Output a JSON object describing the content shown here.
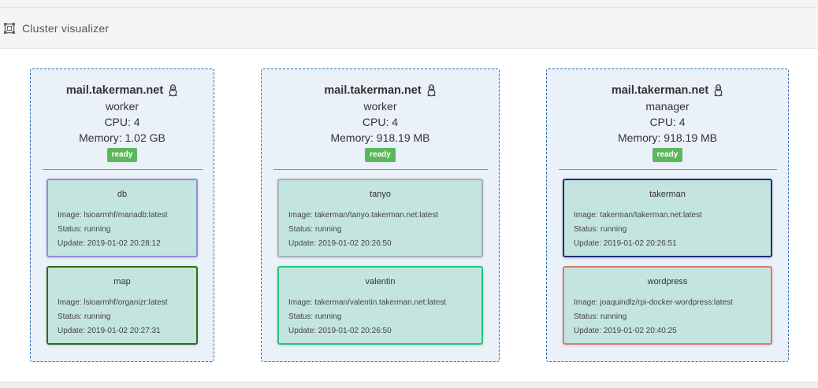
{
  "header": {
    "title": "Cluster visualizer",
    "icon": "cluster-icon"
  },
  "labels": {
    "cpu_prefix": "CPU: ",
    "memory_prefix": "Memory: ",
    "image_prefix": "Image: ",
    "status_prefix": "Status: ",
    "update_prefix": "Update: "
  },
  "nodes": [
    {
      "hostname": "mail.takerman.net",
      "os_icon": "linux-icon",
      "role": "worker",
      "cpu": "CPU: 4",
      "memory": "Memory: 1.02 GB",
      "state": "ready",
      "tasks": [
        {
          "name": "db",
          "image": "Image: lsioarmhf/mariadb:latest",
          "status": "Status: running",
          "update": "Update: 2019-01-02 20:28:12",
          "color": "#8d8fd0"
        },
        {
          "name": "map",
          "image": "Image: lsioarmhf/organizr:latest",
          "status": "Status: running",
          "update": "Update: 2019-01-02 20:27:31",
          "color": "#2a6e12"
        }
      ]
    },
    {
      "hostname": "mail.takerman.net",
      "os_icon": "linux-icon",
      "role": "worker",
      "cpu": "CPU: 4",
      "memory": "Memory: 918.19 MB",
      "state": "ready",
      "tasks": [
        {
          "name": "tanyo",
          "image": "Image: takerman/tanyo.takerman.net:latest",
          "status": "Status: running",
          "update": "Update: 2019-01-02 20:26:50",
          "color": "#a3b3b1"
        },
        {
          "name": "valentin",
          "image": "Image: takerman/valentin.takerman.net:latest",
          "status": "Status: running",
          "update": "Update: 2019-01-02 20:26:50",
          "color": "#22c77a"
        }
      ]
    },
    {
      "hostname": "mail.takerman.net",
      "os_icon": "linux-icon",
      "role": "manager",
      "cpu": "CPU: 4",
      "memory": "Memory: 918.19 MB",
      "state": "ready",
      "tasks": [
        {
          "name": "takerman",
          "image": "Image: takerman/takerman.net:latest",
          "status": "Status: running",
          "update": "Update: 2019-01-02 20:26:51",
          "color": "#1f2d7a"
        },
        {
          "name": "wordpress",
          "image": "Image: joaquindlz/rpi-docker-wordpress:latest",
          "status": "Status: running",
          "update": "Update: 2019-01-02 20:40:25",
          "color": "#d97a7a"
        }
      ]
    }
  ],
  "colors": {
    "node_border": "#2f6fb0",
    "node_bg": "#eaf1f8",
    "task_bg": "#c4e4e0",
    "ready_badge": "#5cb85c"
  }
}
